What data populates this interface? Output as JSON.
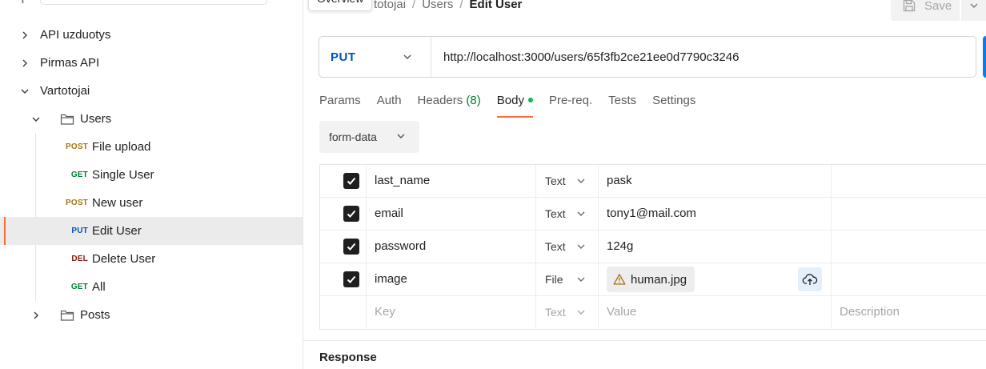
{
  "sidebar": {
    "top": {
      "plus_icon": "plus-icon",
      "filter_icon": "filter-icon",
      "more_icon": "more-icon",
      "filter_glyph": "≑",
      "more_glyph": "ooo"
    },
    "items": [
      {
        "label": "API uzduotys",
        "type": "collection",
        "expanded": false
      },
      {
        "label": "Pirmas API",
        "type": "collection",
        "expanded": false
      },
      {
        "label": "Vartotojai",
        "type": "collection",
        "expanded": true
      },
      {
        "label": "Users",
        "type": "folder",
        "expanded": true
      },
      {
        "method": "POST",
        "label": "File upload",
        "type": "request"
      },
      {
        "method": "GET",
        "label": "Single User",
        "type": "request"
      },
      {
        "method": "POST",
        "label": "New user",
        "type": "request"
      },
      {
        "method": "PUT",
        "label": "Edit User",
        "type": "request",
        "active": true
      },
      {
        "method": "DEL",
        "label": "Delete User",
        "type": "request"
      },
      {
        "method": "GET",
        "label": "All",
        "type": "request"
      },
      {
        "label": "Posts",
        "type": "folder",
        "expanded": false
      }
    ]
  },
  "header": {
    "tooltip": "Overview",
    "breadcrumb": [
      "totojai",
      "Users",
      "Edit User"
    ],
    "save_label": "Save"
  },
  "request": {
    "method": "PUT",
    "url": "http://localhost:3000/users/65f3fb2ce21ee0d7790c3246"
  },
  "tabs": {
    "params": "Params",
    "auth": "Auth",
    "headers": "Headers",
    "headers_count": "(8)",
    "body": "Body",
    "prereq": "Pre-req.",
    "tests": "Tests",
    "settings": "Settings"
  },
  "body": {
    "type": "form-data",
    "rows": [
      {
        "checked": true,
        "key": "last_name",
        "type": "Text",
        "value": "pask"
      },
      {
        "checked": true,
        "key": "email",
        "type": "Text",
        "value": "tony1@mail.com"
      },
      {
        "checked": true,
        "key": "password",
        "type": "Text",
        "value": "124g"
      },
      {
        "checked": true,
        "key": "image",
        "type": "File",
        "value": "human.jpg"
      }
    ],
    "placeholder": {
      "key": "Key",
      "type": "Text",
      "value": "Value",
      "description": "Description"
    }
  },
  "response": {
    "label": "Response"
  },
  "colors": {
    "accent": "#ff6c37",
    "post": "#a57410",
    "get": "#007f31",
    "put": "#0053b8",
    "del": "#8e1a10",
    "send": "#097bed"
  }
}
